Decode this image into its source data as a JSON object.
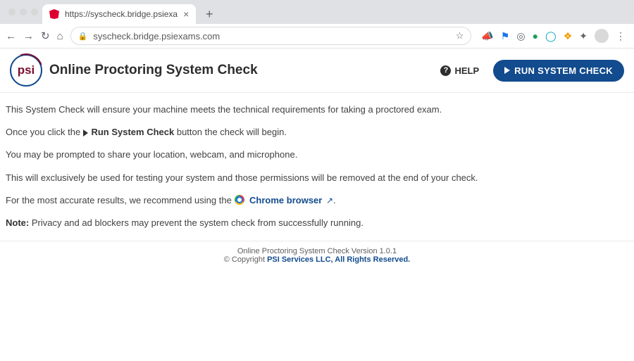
{
  "browser": {
    "tab_title": "https://syscheck.bridge.psiexa",
    "url_display": "syscheck.bridge.psiexams.com"
  },
  "header": {
    "logo_text": "psi",
    "title": "Online Proctoring System Check",
    "help_label": "HELP",
    "run_label": "RUN SYSTEM CHECK"
  },
  "body": {
    "p1": "This System Check will ensure your machine meets the technical requirements for taking a proctored exam.",
    "p2_a": "Once you click the ",
    "p2_b": " Run System Check",
    "p2_c": " button the check will begin.",
    "p3": "You may be prompted to share your location, webcam, and microphone.",
    "p4": "This will exclusively be used for testing your system and those permissions will be removed at the end of your check.",
    "p5_a": "For the most accurate results, we recommend using the ",
    "p5_link": "Chrome browser",
    "p5_b": ".",
    "p6_label": "Note:",
    "p6_text": " Privacy and ad blockers may prevent the system check from successfully running."
  },
  "footer": {
    "line1": "Online Proctoring System Check Version 1.0.1",
    "line2_a": "© Copyright ",
    "line2_link": "PSI Services LLC, All Rights Reserved."
  }
}
